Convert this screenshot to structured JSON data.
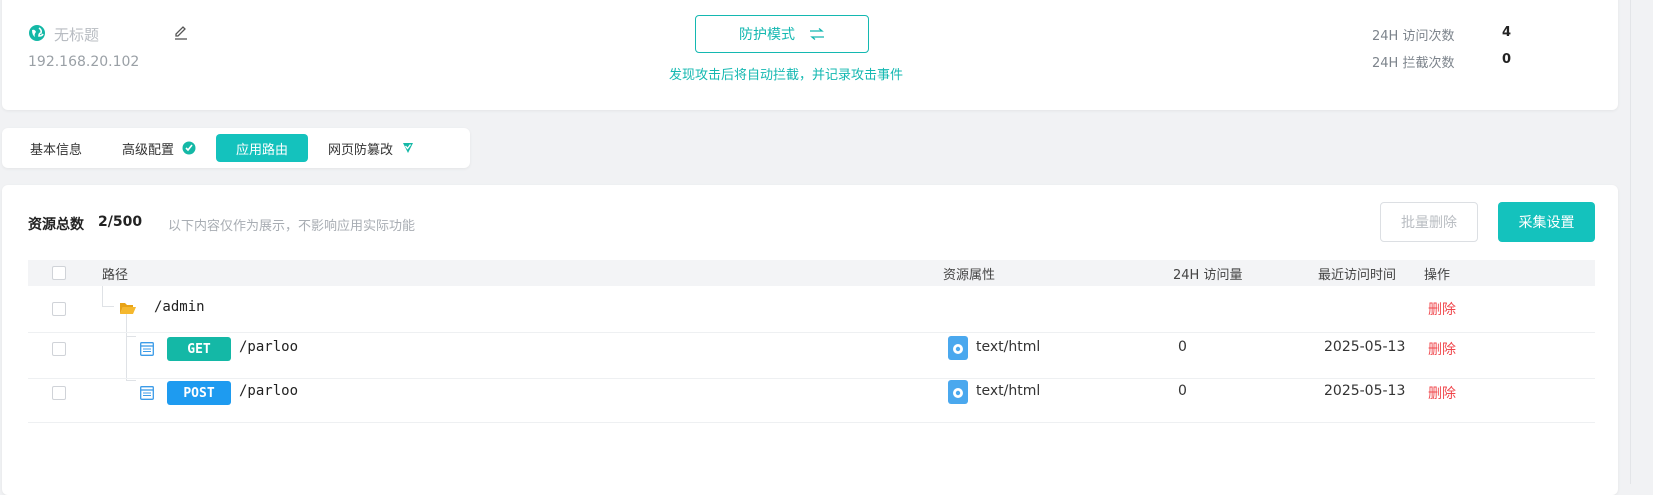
{
  "site": {
    "name": "无标题",
    "ip": "192.168.20.102"
  },
  "mode": {
    "label": "防护模式",
    "description": "发现攻击后将自动拦截，并记录攻击事件"
  },
  "stats": [
    {
      "label": "24H 访问次数",
      "value": "4"
    },
    {
      "label": "24H 拦截次数",
      "value": "0"
    }
  ],
  "tabs": [
    {
      "label": "基本信息",
      "active": false
    },
    {
      "label": "高级配置",
      "active": false
    },
    {
      "label": "应用路由",
      "active": true
    },
    {
      "label": "网页防篡改",
      "active": false
    }
  ],
  "resources": {
    "title": "资源总数",
    "count": "2/500",
    "note": "以下内容仅作为展示，不影响应用实际功能",
    "batch_delete_label": "批量删除",
    "collect_settings_label": "采集设置"
  },
  "table": {
    "headers": {
      "path": "路径",
      "attr": "资源属性",
      "visits": "24H 访问量",
      "last_visit": "最近访问时间",
      "action": "操作"
    },
    "folder": {
      "path": "/admin",
      "action": "删除"
    },
    "rows": [
      {
        "method": "GET",
        "method_color": "#14b8a6",
        "path": "/parloo",
        "attr": "text/html",
        "visits": "0",
        "last_visit": "2025-05-13",
        "action": "删除"
      },
      {
        "method": "POST",
        "method_color": "#1e9bf0",
        "path": "/parloo",
        "attr": "text/html",
        "visits": "0",
        "last_visit": "2025-05-13",
        "action": "删除"
      }
    ]
  },
  "colors": {
    "accent": "#14c2bd",
    "danger": "#f0464b"
  }
}
